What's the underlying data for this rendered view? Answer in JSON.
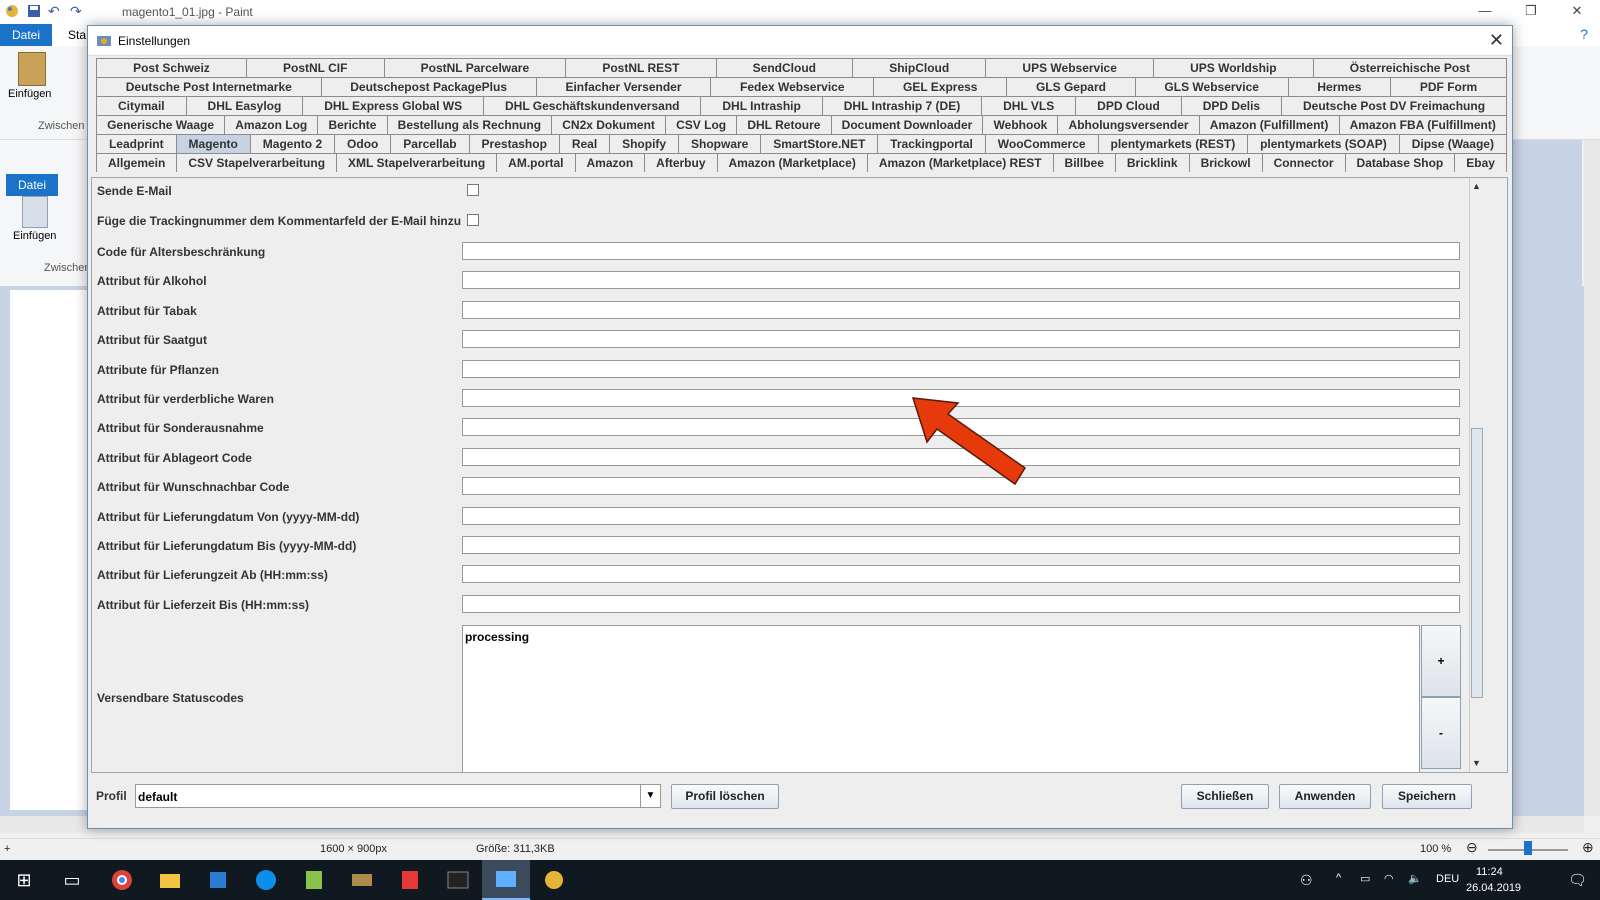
{
  "paint": {
    "window_title": "magento1_01.jpg - Paint",
    "file_tab": "Datei",
    "start_tab": "Sta",
    "paste_label": "Einfügen",
    "clipboard_label": "Zwischen",
    "status_size": "1600 × 900px",
    "status_filesize": "Größe: 311,3KB",
    "zoom": "100 %"
  },
  "taskbar": {
    "lang": "DEU",
    "time": "11:24",
    "date": "26.04.2019"
  },
  "dialog": {
    "title": "Einstellungen",
    "tab_rows": [
      [
        "Post Schweiz",
        "PostNL CIF",
        "PostNL Parcelware",
        "PostNL REST",
        "SendCloud",
        "ShipCloud",
        "UPS Webservice",
        "UPS Worldship",
        "Österreichische Post"
      ],
      [
        "Deutsche Post Internetmarke",
        "Deutschepost PackagePlus",
        "Einfacher Versender",
        "Fedex Webservice",
        "GEL Express",
        "GLS Gepard",
        "GLS Webservice",
        "Hermes",
        "PDF Form"
      ],
      [
        "Citymail",
        "DHL Easylog",
        "DHL Express Global WS",
        "DHL Geschäftskundenversand",
        "DHL Intraship",
        "DHL Intraship 7 (DE)",
        "DHL VLS",
        "DPD Cloud",
        "DPD Delis",
        "Deutsche Post DV Freimachung"
      ],
      [
        "Generische Waage",
        "Amazon Log",
        "Berichte",
        "Bestellung als Rechnung",
        "CN2x Dokument",
        "CSV Log",
        "DHL Retoure",
        "Document Downloader",
        "Webhook",
        "Abholungsversender",
        "Amazon (Fulfillment)",
        "Amazon FBA (Fulfillment)"
      ],
      [
        "Leadprint",
        "Magento",
        "Magento 2",
        "Odoo",
        "Parcellab",
        "Prestashop",
        "Real",
        "Shopify",
        "Shopware",
        "SmartStore.NET",
        "Trackingportal",
        "WooCommerce",
        "plentymarkets (REST)",
        "plentymarkets (SOAP)",
        "Dipse (Waage)"
      ],
      [
        "Allgemein",
        "CSV Stapelverarbeitung",
        "XML Stapelverarbeitung",
        "AM.portal",
        "Amazon",
        "Afterbuy",
        "Amazon (Marketplace)",
        "Amazon (Marketplace) REST",
        "Billbee",
        "Bricklink",
        "Brickowl",
        "Connector",
        "Database Shop",
        "Ebay"
      ]
    ],
    "selected_tab": "Magento",
    "checkboxes": [
      {
        "label": "Sende E-Mail",
        "checked": false
      },
      {
        "label": "Füge die Trackingnummer dem Kommentarfeld der E-Mail hinzu",
        "checked": false
      }
    ],
    "fields": [
      {
        "label": "Code für Altersbeschränkung",
        "value": ""
      },
      {
        "label": "Attribut für Alkohol",
        "value": ""
      },
      {
        "label": "Attribut für Tabak",
        "value": ""
      },
      {
        "label": "Attribut für Saatgut",
        "value": ""
      },
      {
        "label": "Attribute für Pflanzen",
        "value": ""
      },
      {
        "label": "Attribut für verderbliche Waren",
        "value": ""
      },
      {
        "label": "Attribut für Sonderausnahme",
        "value": ""
      },
      {
        "label": "Attribut für Ablageort Code",
        "value": ""
      },
      {
        "label": "Attribut für Wunschnachbar Code",
        "value": ""
      },
      {
        "label": "Attribut für Lieferungdatum Von (yyyy-MM-dd)",
        "value": ""
      },
      {
        "label": "Attribut für Lieferungdatum Bis (yyyy-MM-dd)",
        "value": ""
      },
      {
        "label": "Attribut für Lieferungzeit Ab (HH:mm:ss)",
        "value": ""
      },
      {
        "label": "Attribut für Lieferzeit Bis (HH:mm:ss)",
        "value": ""
      }
    ],
    "status_codes": {
      "label": "Versendbare Statuscodes",
      "value": "processing",
      "add": "+",
      "remove": "-"
    },
    "profile": {
      "label": "Profil",
      "value": "default",
      "delete_button": "Profil löschen"
    },
    "buttons": {
      "close": "Schließen",
      "apply": "Anwenden",
      "save": "Speichern"
    },
    "arrow_color": "#e63a0c"
  }
}
